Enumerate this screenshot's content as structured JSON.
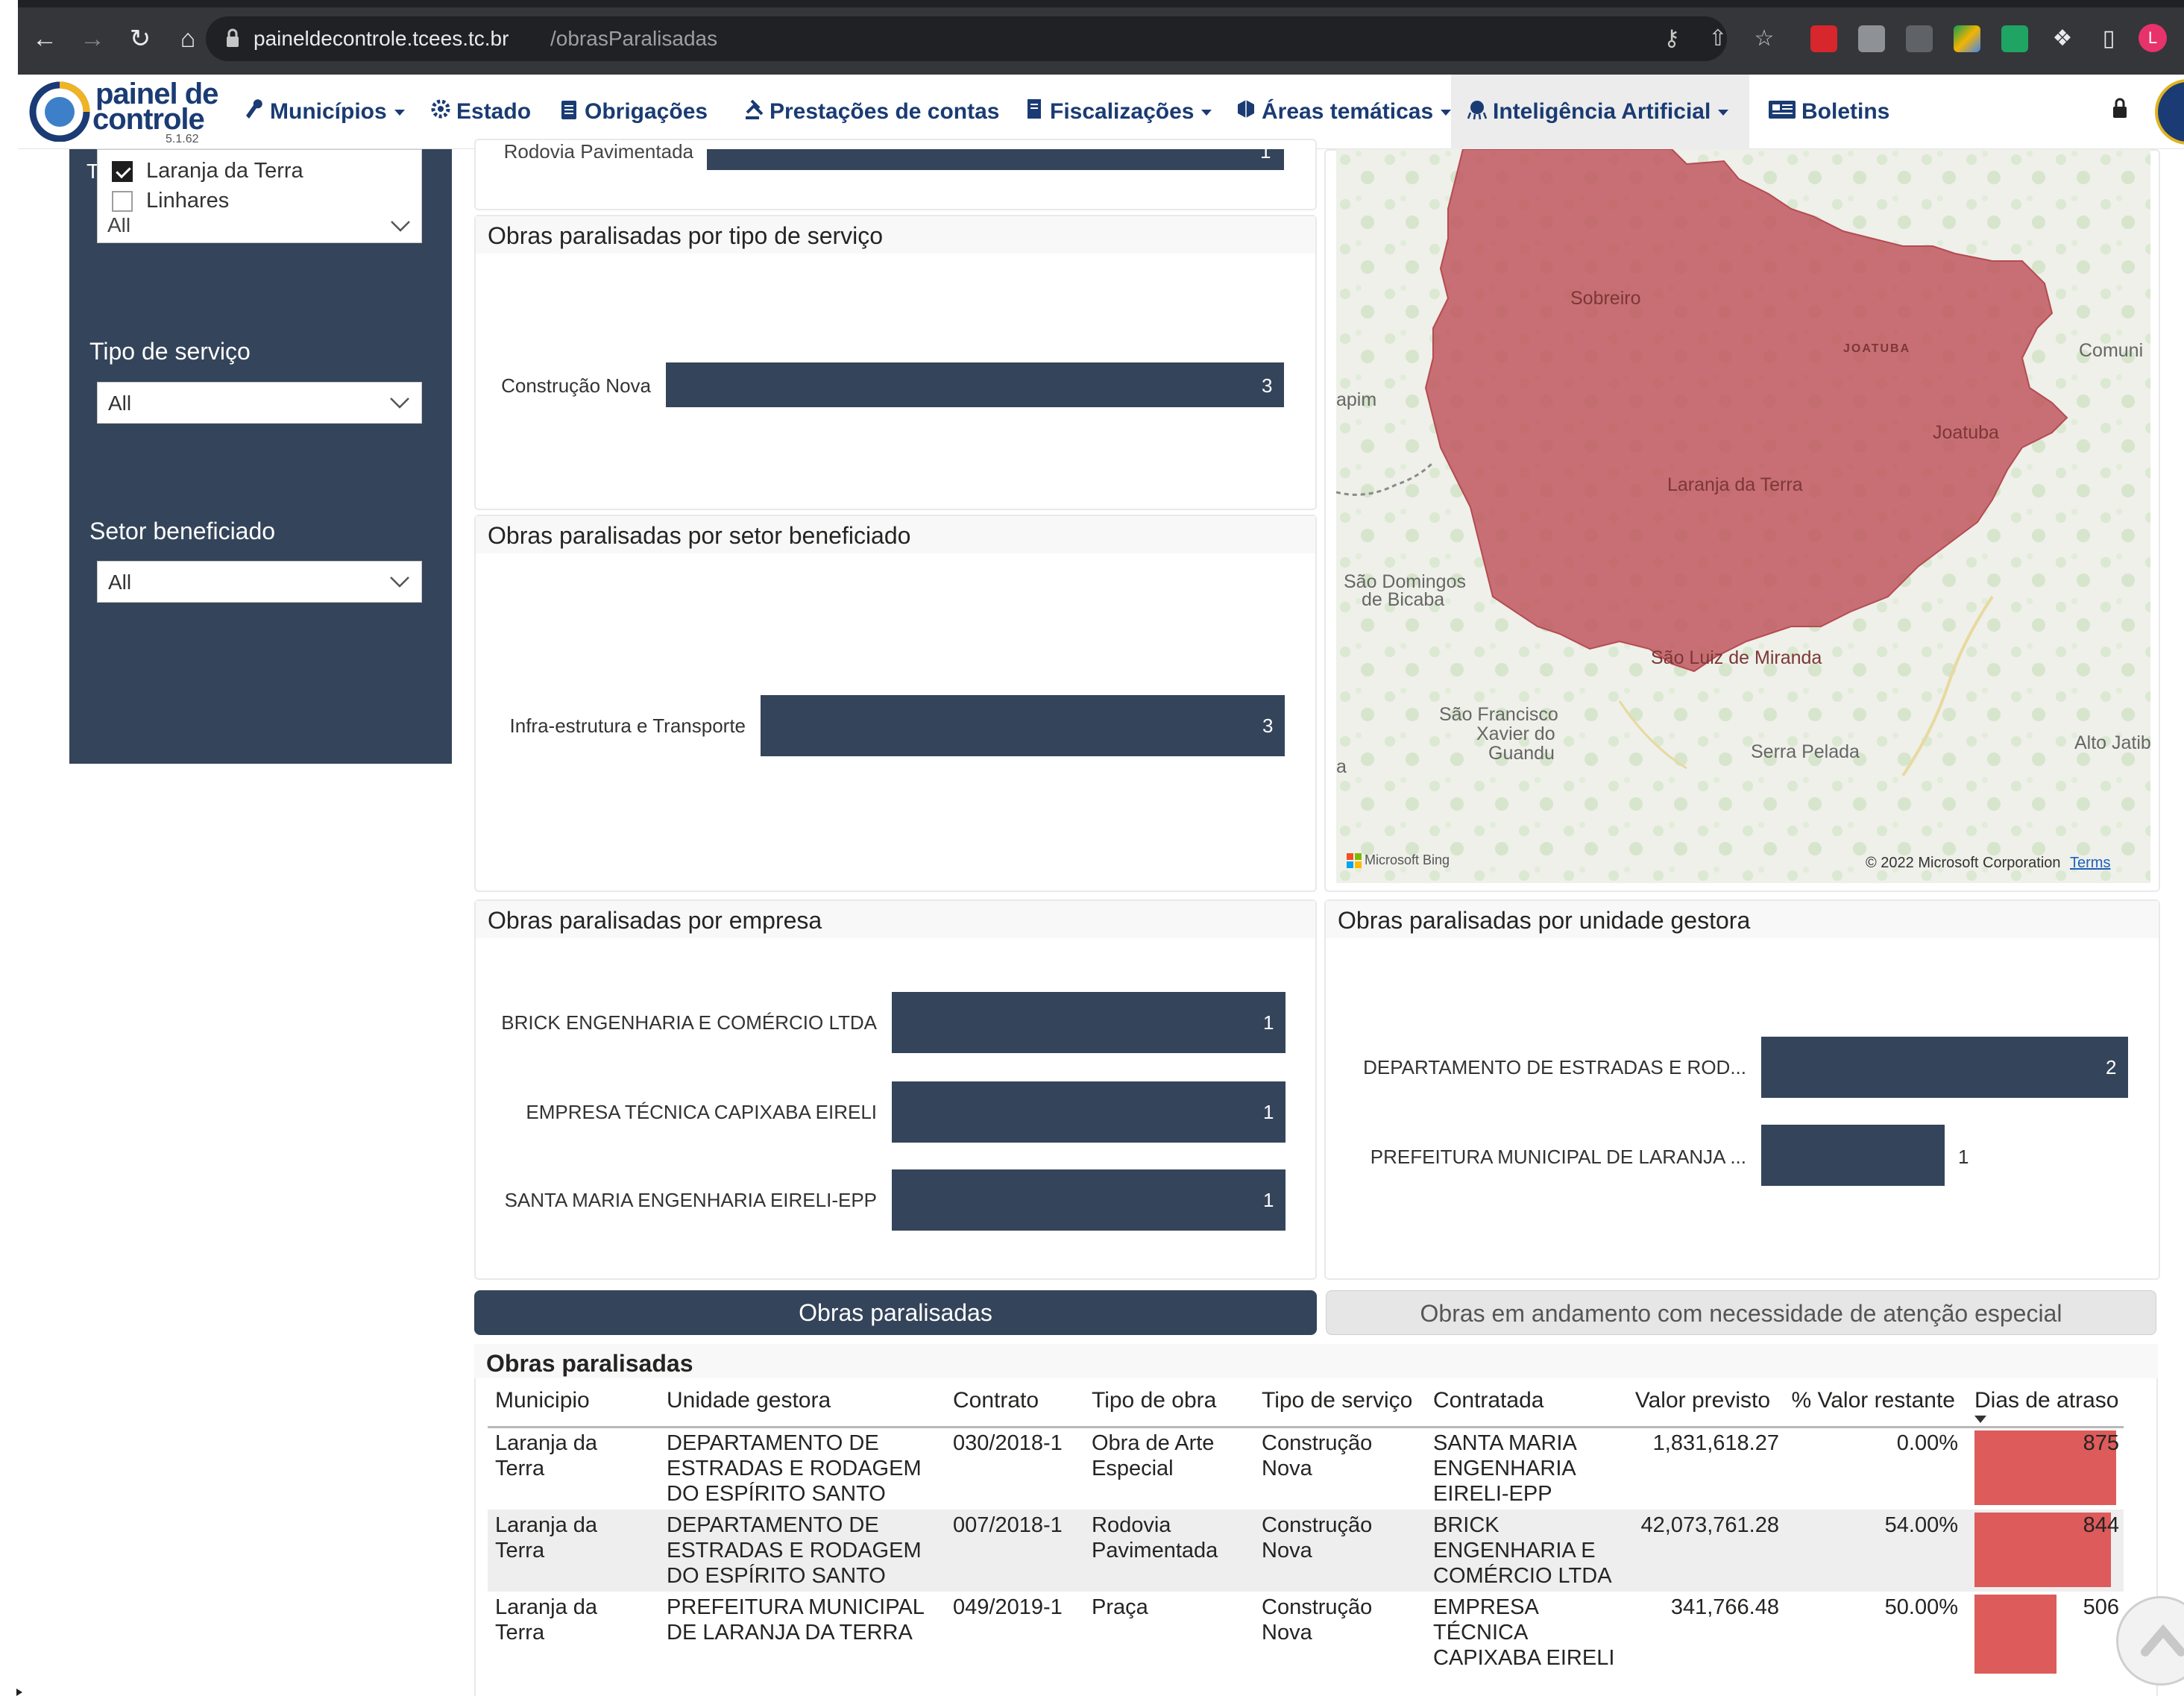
{
  "browser": {
    "url_host": "paineldecontrole.tcees.tc.br",
    "url_path": "/obrasParalisadas",
    "profile_initial": "L"
  },
  "navbar": {
    "brand_line1": "painel de",
    "brand_line2": "controle",
    "version": "5.1.62",
    "items": [
      {
        "label": "Municípios",
        "has_caret": true
      },
      {
        "label": "Estado",
        "has_caret": false
      },
      {
        "label": "Obrigações",
        "has_caret": false
      },
      {
        "label": "Prestações de contas",
        "has_caret": false
      },
      {
        "label": "Fiscalizações",
        "has_caret": true
      },
      {
        "label": "Áreas temáticas",
        "has_caret": true
      },
      {
        "label": "Inteligência Artificial",
        "has_caret": true
      },
      {
        "label": "Boletins",
        "has_caret": false
      }
    ]
  },
  "sidebar": {
    "municipio_options": [
      {
        "label": "Laranja da Terra",
        "checked": true
      },
      {
        "label": "Linhares",
        "checked": false
      }
    ],
    "stub_select_value": "All",
    "filters": [
      {
        "label": "Tipo de serviço",
        "value": "All"
      },
      {
        "label": "Setor beneficiado",
        "value": "All"
      }
    ]
  },
  "charts": {
    "top_partial": {
      "label": "Rodovia Pavimentada",
      "value": 1
    },
    "tipo_servico": {
      "title": "Obras paralisadas por tipo de serviço",
      "chart_data": {
        "type": "bar",
        "orientation": "horizontal",
        "categories": [
          "Construção Nova"
        ],
        "values": [
          3
        ]
      }
    },
    "setor_beneficiado": {
      "title": "Obras paralisadas por setor beneficiado",
      "chart_data": {
        "type": "bar",
        "orientation": "horizontal",
        "categories": [
          "Infra-estrutura e Transporte"
        ],
        "values": [
          3
        ]
      }
    },
    "empresa": {
      "title": "Obras paralisadas por empresa",
      "chart_data": {
        "type": "bar",
        "orientation": "horizontal",
        "categories": [
          "BRICK ENGENHARIA E COMÉRCIO LTDA",
          "EMPRESA TÉCNICA CAPIXABA EIRELI",
          "SANTA MARIA ENGENHARIA EIRELI-EPP"
        ],
        "values": [
          1,
          1,
          1
        ]
      }
    },
    "unidade_gestora": {
      "title": "Obras paralisadas por unidade gestora",
      "chart_data": {
        "type": "bar",
        "orientation": "horizontal",
        "categories": [
          "DEPARTAMENTO DE ESTRADAS E ROD...",
          "PREFEITURA MUNICIPAL DE LARANJA ..."
        ],
        "values": [
          2,
          1
        ],
        "xlim": [
          0,
          2
        ]
      }
    }
  },
  "map": {
    "labels": {
      "sobreiro": "Sobreiro",
      "joatuba_caps": "JOATUBA",
      "comunidade": "Comuni",
      "apim": "apim",
      "joatuba": "Joatuba",
      "laranja": "Laranja da Terra",
      "sao_domingos_1": "São Domingos",
      "sao_domingos_2": "de Bicaba",
      "sao_luiz": "São Luiz de Miranda",
      "sao_francisco_1": "São Francisco",
      "sao_francisco_2": "Xavier do",
      "sao_francisco_3": "Guandu",
      "serra_pelada": "Serra Pelada",
      "alto_jatib": "Alto Jatib",
      "edge_a": "a"
    },
    "bing": "Microsoft Bing",
    "copyright": "© 2022 Microsoft Corporation",
    "terms": "Terms",
    "region_color": "#c0585f"
  },
  "tabs": {
    "active": "Obras paralisadas",
    "inactive": "Obras em andamento com necessidade de atenção especial"
  },
  "table": {
    "title": "Obras paralisadas",
    "headers": {
      "municipio": "Municipio",
      "unidade": "Unidade gestora",
      "contrato": "Contrato",
      "tipo_obra": "Tipo de obra",
      "tipo_servico": "Tipo de serviço",
      "contratada": "Contratada",
      "valor": "Valor previsto",
      "restante": "% Valor restante",
      "dias": "Dias de atraso"
    },
    "delay_max": 875,
    "rows": [
      {
        "municipio_1": "Laranja da",
        "municipio_2": "Terra",
        "unidade_1": "DEPARTAMENTO DE",
        "unidade_2": "ESTRADAS E RODAGEM",
        "unidade_3": "DO ESPÍRITO SANTO",
        "contrato": "030/2018-1",
        "tipo_obra_1": "Obra de Arte",
        "tipo_obra_2": "Especial",
        "tipo_servico_1": "Construção",
        "tipo_servico_2": "Nova",
        "contratada_1": "SANTA MARIA",
        "contratada_2": "ENGENHARIA",
        "contratada_3": "EIRELI-EPP",
        "valor": "1,831,618.27",
        "restante": "0.00%",
        "dias": 875
      },
      {
        "municipio_1": "Laranja da",
        "municipio_2": "Terra",
        "unidade_1": "DEPARTAMENTO DE",
        "unidade_2": "ESTRADAS E RODAGEM",
        "unidade_3": "DO ESPÍRITO SANTO",
        "contrato": "007/2018-1",
        "tipo_obra_1": "Rodovia",
        "tipo_obra_2": "Pavimentada",
        "tipo_servico_1": "Construção",
        "tipo_servico_2": "Nova",
        "contratada_1": "BRICK",
        "contratada_2": "ENGENHARIA E",
        "contratada_3": "COMÉRCIO LTDA",
        "valor": "42,073,761.28",
        "restante": "54.00%",
        "dias": 844
      },
      {
        "municipio_1": "Laranja da",
        "municipio_2": "Terra",
        "unidade_1": "PREFEITURA MUNICIPAL",
        "unidade_2": "DE LARANJA DA TERRA",
        "unidade_3": "",
        "contrato": "049/2019-1",
        "tipo_obra_1": "Praça",
        "tipo_obra_2": "",
        "tipo_servico_1": "Construção",
        "tipo_servico_2": "Nova",
        "contratada_1": "EMPRESA",
        "contratada_2": "TÉCNICA",
        "contratada_3": "CAPIXABA EIRELI",
        "valor": "341,766.48",
        "restante": "50.00%",
        "dias": 506
      }
    ]
  }
}
